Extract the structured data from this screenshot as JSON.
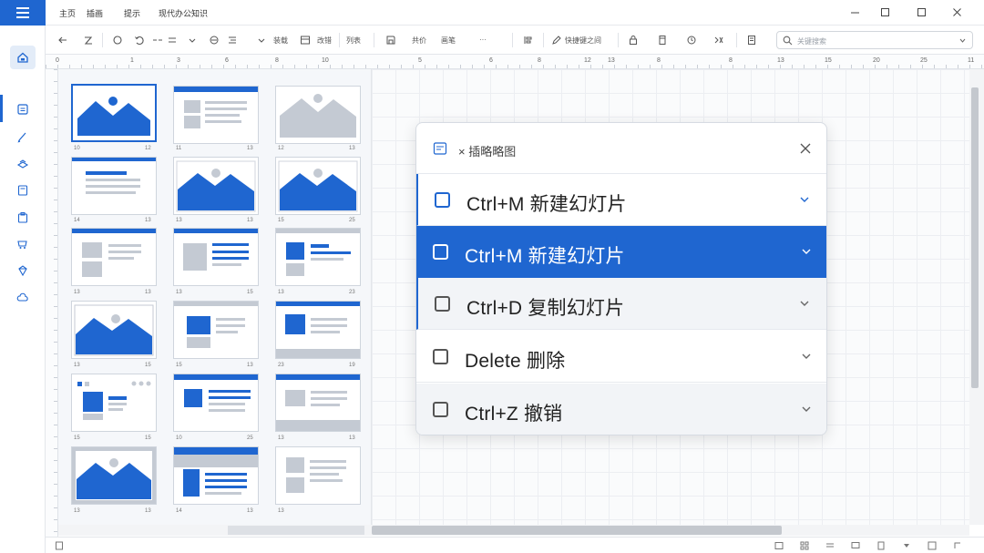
{
  "menu": {
    "tabs": [
      "主页",
      "插画",
      "提示",
      "现代办公知识"
    ]
  },
  "toolbar": {
    "labels": [
      "装载",
      "改错",
      "列表",
      "共价",
      "画笔",
      "快捷键之间",
      "···"
    ],
    "search_placeholder": "关键搜索"
  },
  "ruler": {
    "numbers": [
      "0",
      "1",
      "3",
      "6",
      "8",
      "10",
      "5",
      "6",
      "8",
      "12",
      "13",
      "8",
      "8",
      "13",
      "15",
      "20",
      "25",
      "11",
      "13"
    ]
  },
  "thumbnails": {
    "numbers": [
      "10",
      "12",
      "11",
      "13",
      "12",
      "13",
      "14",
      "13",
      "13",
      "13",
      "15",
      "25",
      "13",
      "13",
      "13",
      "15",
      "13",
      "23",
      "13",
      "15",
      "15",
      "13",
      "23",
      "19",
      "15",
      "15",
      "10",
      "25",
      "13",
      "13",
      "13",
      "13",
      "14",
      "13",
      "13"
    ]
  },
  "popup": {
    "title": "× 插略略图",
    "items": [
      {
        "label": "Ctrl+M 新建幻灯片"
      },
      {
        "label": "Ctrl+M 新建幻灯片"
      },
      {
        "label": "Ctrl+D 复制幻灯片"
      },
      {
        "label": "Delete 删除"
      },
      {
        "label": "Ctrl+Z 撤销"
      }
    ]
  },
  "colors": {
    "accent": "#1f66d0",
    "placeholder": "#c4cad3"
  }
}
